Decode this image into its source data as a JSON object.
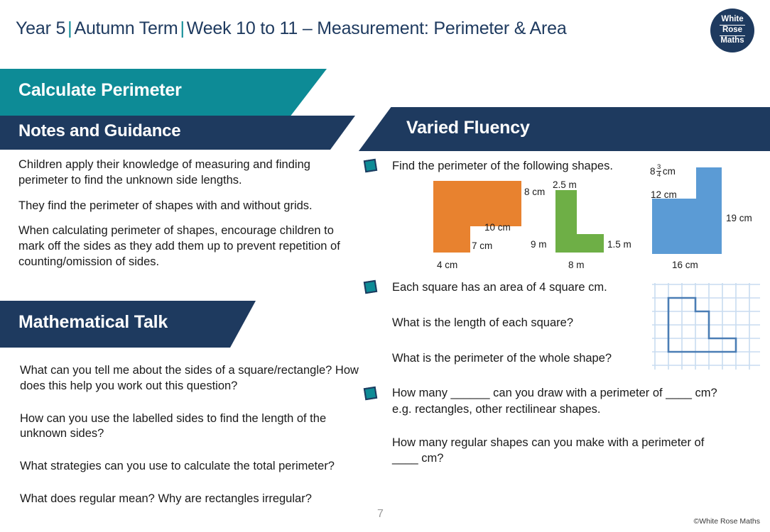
{
  "header": {
    "year": "Year 5",
    "term": "Autumn Term",
    "week": "Week 10 to 11 – Measurement: Perimeter & Area",
    "separator": "|",
    "logo": {
      "line1": "White",
      "line2": "Rose",
      "line3": "Maths"
    }
  },
  "left_panel": {
    "topic_title": "Calculate Perimeter",
    "notes_title": "Notes and Guidance",
    "notes_paragraphs": [
      "Children apply their knowledge of measuring and finding perimeter to find the unknown side lengths.",
      "They find the perimeter of shapes with and without grids.",
      "When calculating perimeter of shapes, encourage children to mark off the sides as they add them up to prevent repetition of counting/omission of sides."
    ],
    "talk_title": "Mathematical Talk",
    "talk_questions": [
      "What can you tell me about the sides of a square/rectangle? How does this help you work out this question?",
      "How can you use the labelled sides to find the length of the unknown sides?",
      "What strategies can you use to calculate the total perimeter?",
      "What does regular mean?  Why are rectangles irregular?"
    ]
  },
  "right_panel": {
    "title": "Varied Fluency",
    "q1": {
      "prompt": "Find the perimeter of the following shapes.",
      "shapes": [
        {
          "name": "orange-l-shape",
          "color": "#E8822F",
          "labels": {
            "right": "8 cm",
            "inner_horizontal": "10 cm",
            "inner_vertical": "7 cm",
            "bottom": "4 cm"
          }
        },
        {
          "name": "green-l-shape",
          "color": "#6EAF46",
          "labels": {
            "top": "2.5 m",
            "left": "9 m",
            "right": "1.5 m",
            "bottom": "8 m"
          }
        },
        {
          "name": "blue-l-shape",
          "color": "#5B9BD5",
          "labels": {
            "top_whole": "8",
            "top_numerator": "3",
            "top_denominator": "4",
            "top_unit": "cm",
            "inner_horizontal": "12 cm",
            "right": "19 cm",
            "bottom": "16 cm"
          }
        }
      ]
    },
    "q2": {
      "statement": "Each square has an area of 4 square cm.",
      "question_a": "What is the length of each square?",
      "question_b": "What is the perimeter of the whole shape?",
      "grid": {
        "columns": 8,
        "rows": 7,
        "grid_color": "#c8dcf0",
        "outline_color": "#4a7db5"
      }
    },
    "q3": {
      "line1": "How many ______ can you draw with a perimeter of ____ cm?",
      "line2": "e.g. rectangles, other rectilinear shapes.",
      "line3": "How many regular shapes can you make with a perimeter of ____ cm?"
    }
  },
  "footer": {
    "page_number": "7",
    "copyright": "©White Rose Maths"
  },
  "colors": {
    "teal": "#0d8b96",
    "navy": "#1e3a5f",
    "orange": "#E8822F",
    "green": "#6EAF46",
    "blue": "#5B9BD5"
  }
}
